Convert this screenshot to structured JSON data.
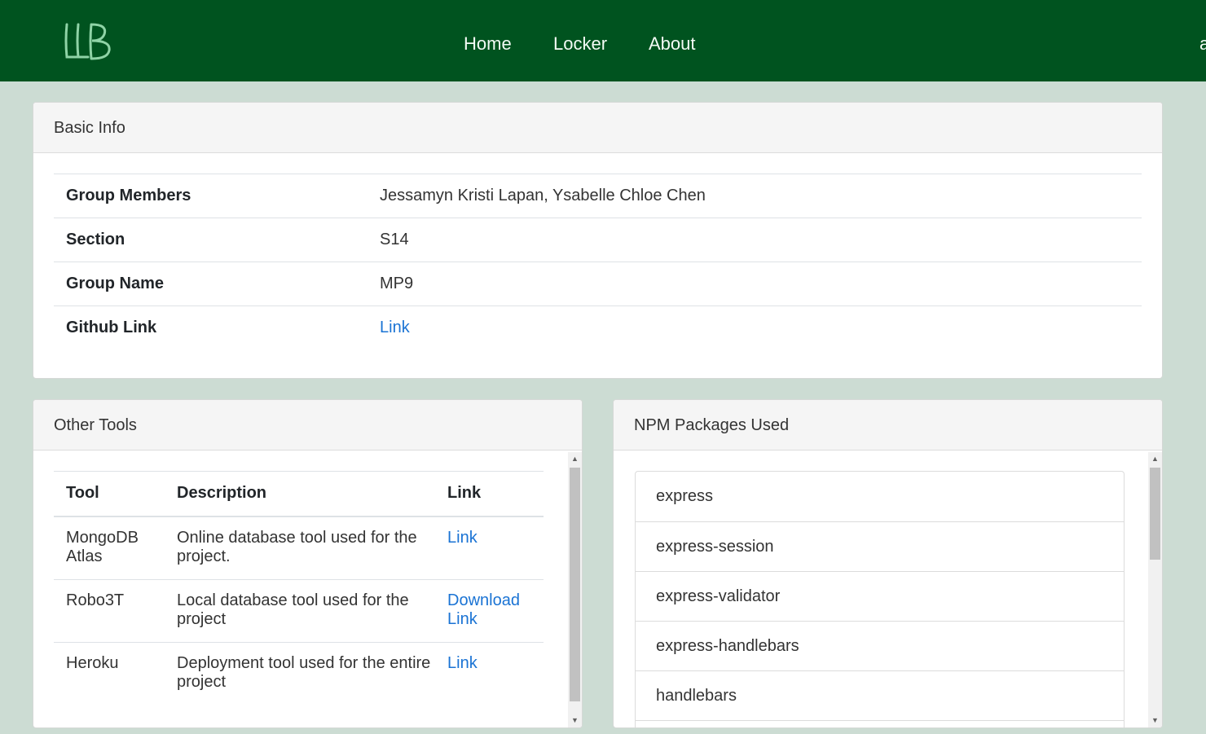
{
  "nav": {
    "logo_text": "LLB",
    "links": [
      "Home",
      "Locker",
      "About"
    ],
    "edge_text": "a"
  },
  "basic_info": {
    "title": "Basic Info",
    "rows": [
      {
        "key": "Group Members",
        "value": "Jessamyn Kristi Lapan, Ysabelle Chloe Chen"
      },
      {
        "key": "Section",
        "value": "S14"
      },
      {
        "key": "Group Name",
        "value": "MP9"
      },
      {
        "key": "Github Link",
        "value": "Link"
      }
    ]
  },
  "other_tools": {
    "title": "Other Tools",
    "headers": [
      "Tool",
      "Description",
      "Link"
    ],
    "rows": [
      {
        "tool": "MongoDB Atlas",
        "description": "Online database tool used for the project.",
        "link": "Link"
      },
      {
        "tool": "Robo3T",
        "description": "Local database tool used for the project",
        "link": "Download Link"
      },
      {
        "tool": "Heroku",
        "description": "Deployment tool used for the entire project",
        "link": "Link"
      }
    ]
  },
  "npm_packages": {
    "title": "NPM Packages Used",
    "items": [
      "express",
      "express-session",
      "express-validator",
      "express-handlebars",
      "handlebars"
    ]
  },
  "icons": {
    "scroll_up": "scroll-up-arrow-icon",
    "scroll_down": "scroll-down-arrow-icon"
  },
  "colors": {
    "navbar": "#00531f",
    "background": "#ccdcd3",
    "link": "#1a73d4",
    "logo": "#8fd3a6"
  }
}
